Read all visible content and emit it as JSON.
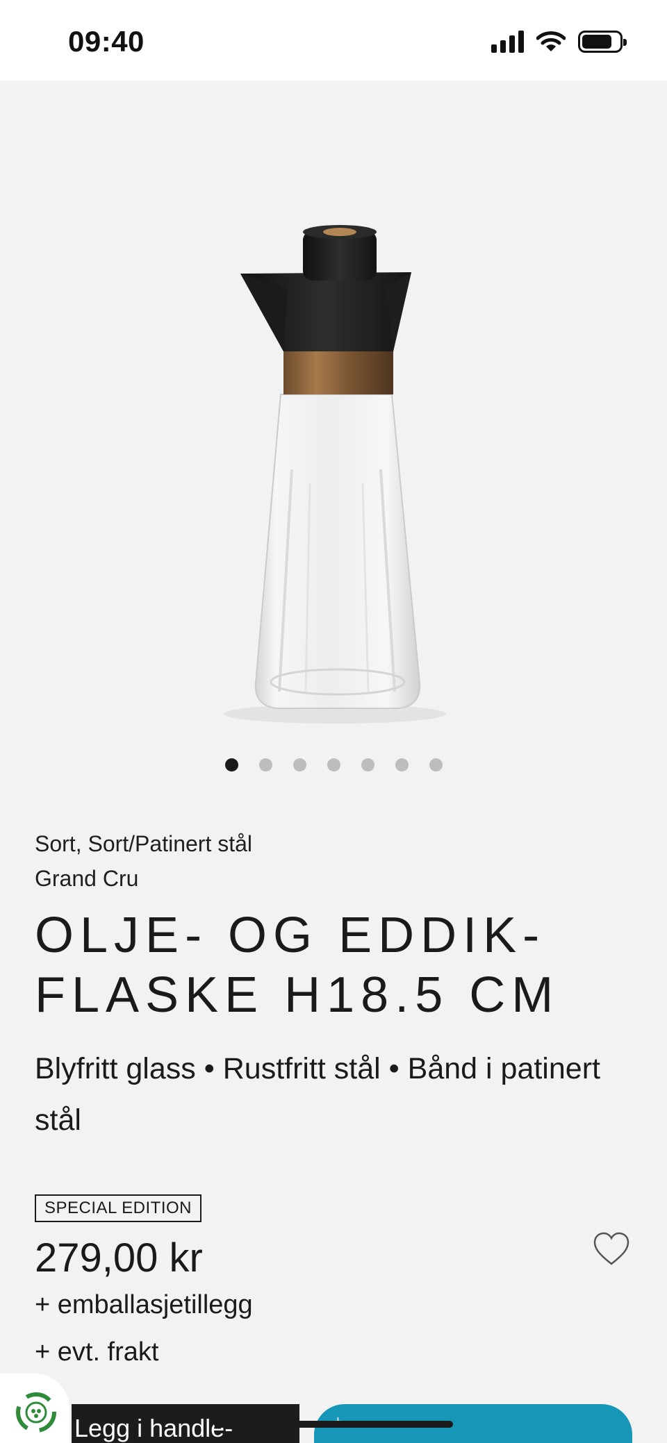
{
  "status_bar": {
    "time": "09:40"
  },
  "product": {
    "image_alt": "Grand Cru oil and vinegar bottle",
    "carousel": {
      "count": 7,
      "active_index": 0
    },
    "color": "Sort, Sort/Patinert stål",
    "collection": "Grand Cru",
    "title": "OLJE- OG EDDIK-FLASKE H18.5 CM",
    "materials": "Blyfritt glass  •  Rustfritt stål  •  Bånd i patinert stål",
    "badge": "SPECIAL EDITION",
    "price": "279,00 kr",
    "extra_fees": [
      "+ emballasjetillegg",
      "+ evt. frakt"
    ]
  },
  "actions": {
    "add_to_cart": "Legg i handle-",
    "teal_button_plus": "+"
  },
  "colors": {
    "accent_teal": "#1697b7",
    "background": "#f2f2f2",
    "text": "#1a1a1a"
  }
}
